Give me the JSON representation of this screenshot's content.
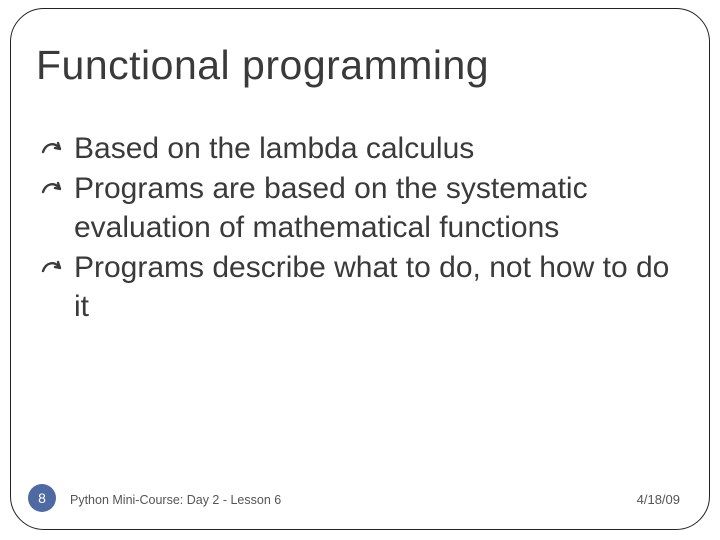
{
  "slide": {
    "title": "Functional programming",
    "bullets": [
      "Based on the lambda calculus",
      "Programs are based on the systematic evaluation of mathematical functions",
      "Programs describe what to do, not how to do it"
    ],
    "footer": {
      "page": "8",
      "course": "Python Mini-Course: Day 2 - Lesson 6",
      "date": "4/18/09"
    }
  }
}
